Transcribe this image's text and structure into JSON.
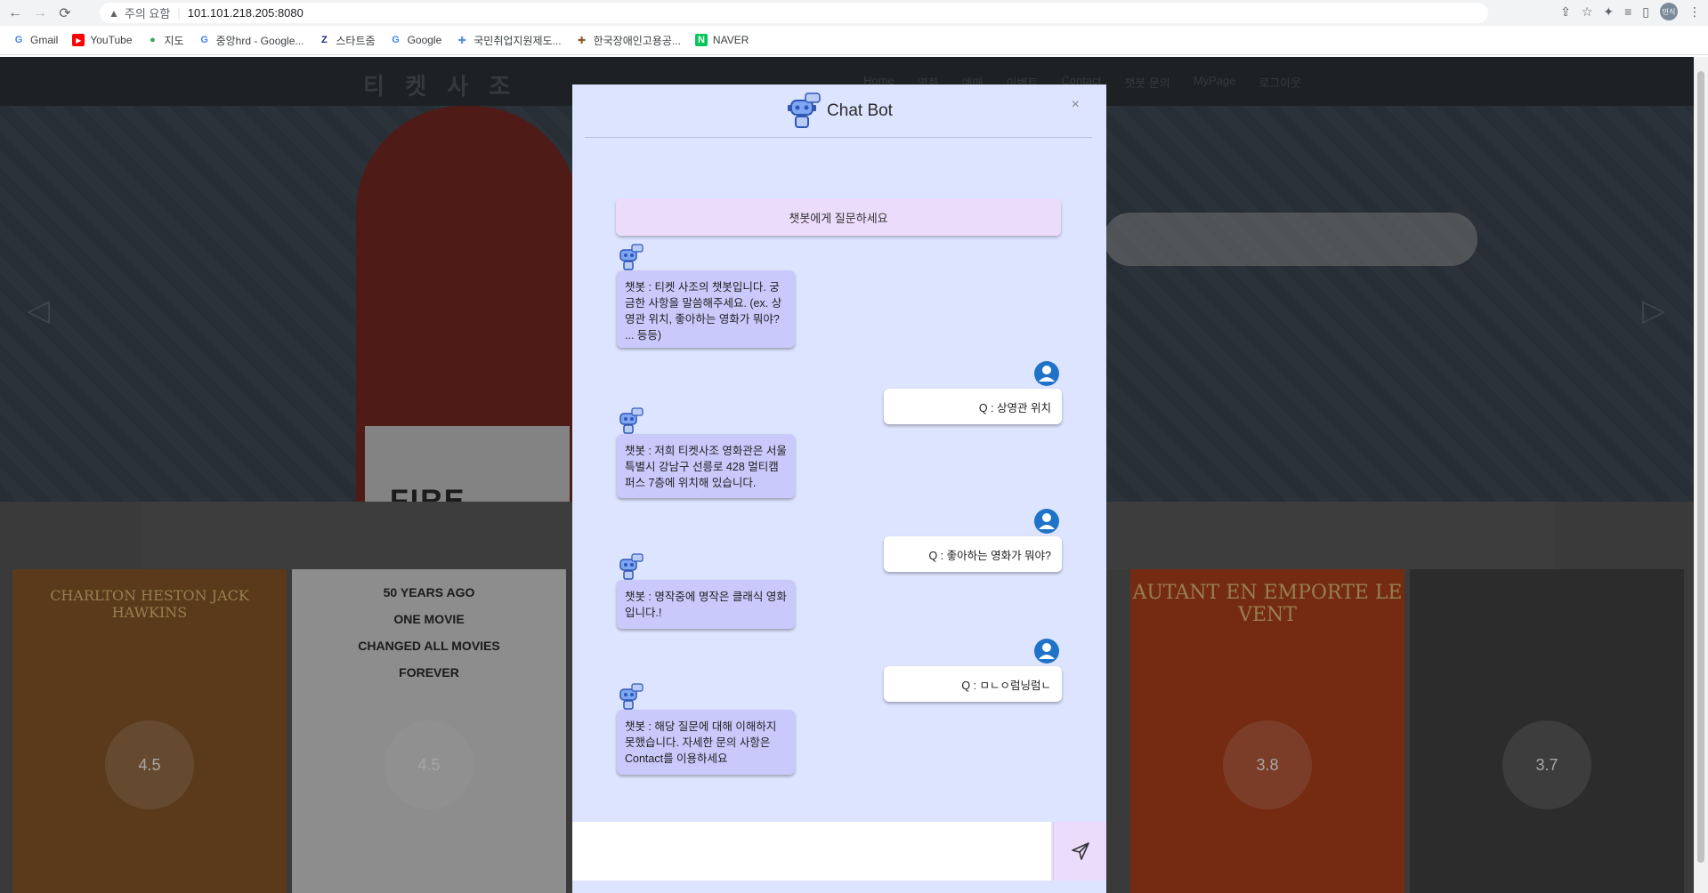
{
  "browser": {
    "security_label": "주의 요함",
    "url": "101.101.218.205:8080",
    "profile_label": "민식",
    "bookmarks": [
      {
        "label": "Gmail",
        "icon": "G",
        "color": "#4285f4"
      },
      {
        "label": "YouTube",
        "icon": "▶",
        "color": "#ff0000"
      },
      {
        "label": "지도",
        "icon": "●",
        "color": "#34a853"
      },
      {
        "label": "중앙hrd - Google...",
        "icon": "G",
        "color": "#4285f4"
      },
      {
        "label": "스타트줌",
        "icon": "Z",
        "color": "#1a2b8c"
      },
      {
        "label": "Google",
        "icon": "G",
        "color": "#4285f4"
      },
      {
        "label": "국민취업지원제도...",
        "icon": "✚",
        "color": "#5c8fd6"
      },
      {
        "label": "한국장애인고용공...",
        "icon": "✚",
        "color": "#8b5a2b"
      },
      {
        "label": "NAVER",
        "icon": "N",
        "color": "#03c75a"
      }
    ]
  },
  "site": {
    "logo": "티 켓 사 조",
    "nav": [
      "Home",
      "영화",
      "예매",
      "이벤트",
      "Contact",
      "챗봇 문의",
      "MyPage",
      "로그아웃"
    ],
    "hero_text": "FIRE",
    "posters": [
      {
        "title": "CHARLTON HESTON  JACK HAWKINS",
        "rating": "4.5",
        "bg": "#8a5a2a"
      },
      {
        "lines": [
          "50 YEARS AGO",
          "ONE MOVIE",
          "CHANGED ALL MOVIES",
          "FOREVER"
        ],
        "rating": "4.5",
        "bg": "#d9d9d9"
      },
      {
        "title": "",
        "rating": "",
        "bg": "#5a5a5a"
      },
      {
        "title": "",
        "rating": "",
        "bg": "#5a5a5a"
      },
      {
        "title": "AUTANT EN EMPORTE LE VENT",
        "rating": "3.8",
        "bg": "#b2431c"
      },
      {
        "title": "",
        "rating": "3.7",
        "bg": "#444"
      }
    ]
  },
  "chat": {
    "title": "Chat Bot",
    "close": "×",
    "prompt": "챗봇에게 질문하세요",
    "bot_1": "챗봇 : 티켓 사조의 챗봇입니다. 궁금한 사항을 말씀해주세요. (ex. 상영관 위치, 좋아하는 영화가 뭐야? ... 등등)",
    "user_1": "Q : 상영관 위치",
    "bot_2": "챗봇 : 저희 티켓사조 영화관은 서울특별시 강남구 선릉로 428 멀티캠퍼스 7층에 위치해 있습니다.",
    "user_2": "Q : 좋아하는 영화가 뭐야?",
    "bot_3": "챗봇 : 명작중에 명작은 클래식 영화입니다.!",
    "user_3": "Q : ㅁㄴㅇ럼닝럼ㄴ",
    "bot_4": "챗봇 : 해당 질문에 대해 이해하지 못했습니다. 자세한 문의 사항은 Contact를 이용하세요",
    "input_value": "",
    "input_placeholder": ""
  },
  "colors": {
    "modal_bg": "#dde4ff",
    "bot_bubble": "#c9c9fb",
    "prompt_bg": "#ecdcfb",
    "user_bubble": "#ffffff"
  }
}
